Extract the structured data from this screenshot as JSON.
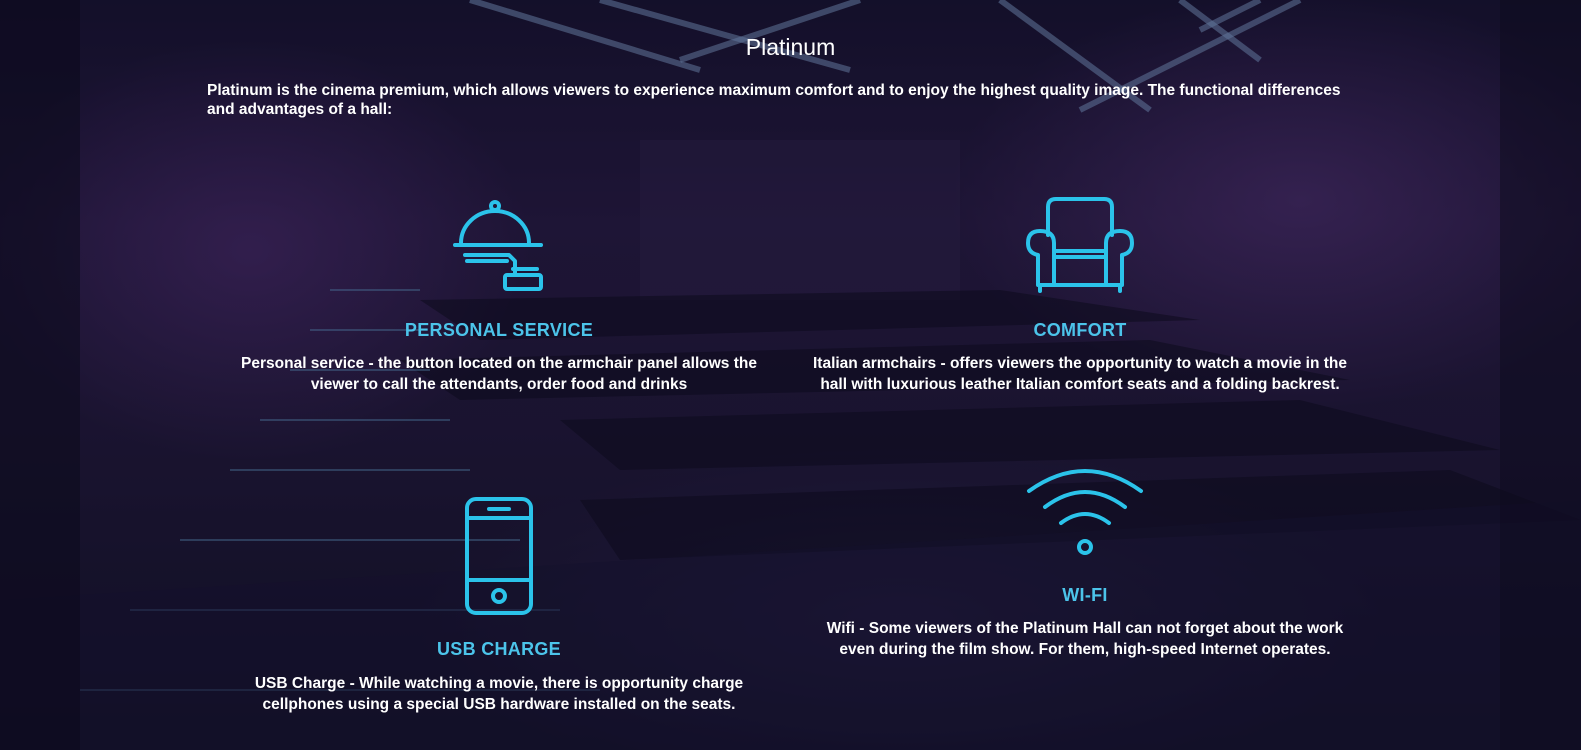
{
  "page": {
    "title": "Platinum",
    "intro": "Platinum is the cinema premium, which allows viewers to experience maximum comfort and to enjoy the highest quality image. The functional differences and advantages of a hall:"
  },
  "features": [
    {
      "icon": "cloche-icon",
      "name": "PERSONAL SERVICE",
      "desc": "Personal service - the button located on the armchair panel allows the viewer to call the attendants, order food and drinks"
    },
    {
      "icon": "armchair-icon",
      "name": "COMFORT",
      "desc": "Italian armchairs - offers viewers the opportunity to watch a movie in the hall with luxurious leather Italian comfort seats and a folding backrest."
    },
    {
      "icon": "smartphone-icon",
      "name": "USB CHARGE",
      "desc": "USB Charge - While watching a movie, there is opportunity charge cellphones using a special USB hardware installed on the seats."
    },
    {
      "icon": "wifi-icon",
      "name": "WI-FI",
      "desc": "Wifi - Some viewers of the Platinum Hall can not forget about the work even during the film show. For them, high-speed Internet operates."
    }
  ],
  "colors": {
    "accent": "#2bc3ea",
    "heading": "#4cc4ea",
    "text": "#ffffff",
    "background": "#1e1838"
  }
}
